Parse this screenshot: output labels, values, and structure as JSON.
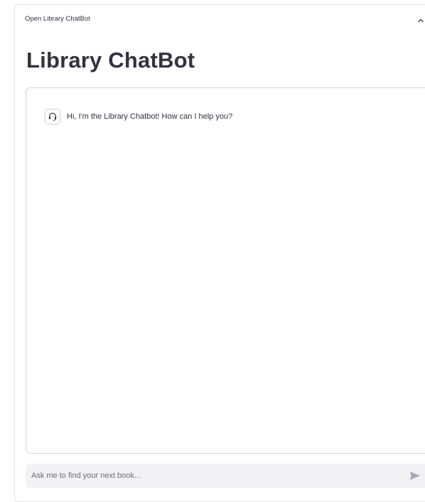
{
  "expander": {
    "label": "Open Library ChatBot",
    "state": "expanded"
  },
  "page": {
    "title": "Library ChatBot"
  },
  "chat": {
    "messages": [
      {
        "role": "assistant",
        "avatar_icon": "headset-icon",
        "text": "Hi, I'm the Library Chatbot! How can I help you?"
      }
    ]
  },
  "chat_input": {
    "placeholder": "Ask me to find your next book...",
    "value": "",
    "send_icon": "send-icon"
  },
  "colors": {
    "text": "#31333f",
    "border": "#d6d6dc",
    "input_background": "#f0f2f6",
    "send_icon": "#a3a8b4"
  }
}
